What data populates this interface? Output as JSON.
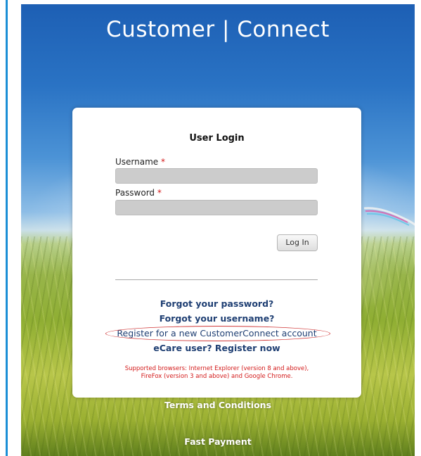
{
  "brand": {
    "logo_text": "Customer | Connect",
    "accent_color": "#1b8fd6"
  },
  "login": {
    "title": "User Login",
    "username_label": "Username",
    "password_label": "Password",
    "required_marker": "*",
    "username_value": "",
    "password_value": "",
    "login_button": "Log In"
  },
  "links": {
    "forgot_password": "Forgot your password?",
    "forgot_username": "Forgot your username?",
    "register_new": "Register for a new CustomerConnect account",
    "ecare_register": "eCare user? Register now"
  },
  "notice": {
    "line1": "Supported browsers: Internet Explorer (version 8 and above),",
    "line2": "FireFox (version 3 and above) and Google Chrome."
  },
  "footer": {
    "terms": "Terms and Conditions",
    "fast_payment": "Fast Payment"
  },
  "icons": {
    "highlight_annotation": "red-ellipse-annotation"
  }
}
